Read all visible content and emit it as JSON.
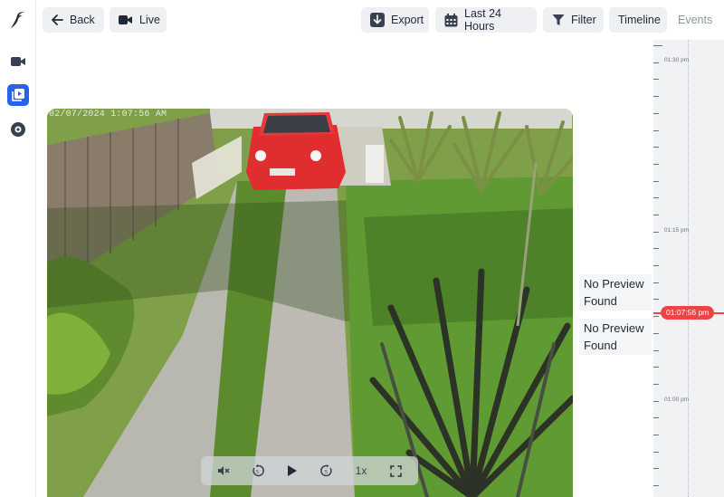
{
  "sidebar": {
    "logo": "bird-logo",
    "items": [
      {
        "name": "cameras",
        "icon": "video-camera-icon",
        "active": false
      },
      {
        "name": "recordings",
        "icon": "play-library-icon",
        "active": true
      },
      {
        "name": "storage",
        "icon": "disc-icon",
        "active": false
      }
    ]
  },
  "toolbar": {
    "back_label": "Back",
    "live_label": "Live",
    "export_label": "Export",
    "range_label": "Last 24 Hours",
    "filter_label": "Filter",
    "timeline_label": "Timeline",
    "events_label": "Events"
  },
  "video": {
    "timestamp": "02/07/2024 1:07:56 AM"
  },
  "controls": {
    "mute_icon": "mute-icon",
    "rewind_icon": "rewind-5-icon",
    "play_icon": "play-icon",
    "forward_icon": "forward-5-icon",
    "speed_label": "1x",
    "fullscreen_icon": "fullscreen-icon"
  },
  "previews": [
    {
      "text": "No Preview Found"
    },
    {
      "text": "No Preview Found"
    }
  ],
  "timeline": {
    "labels": [
      "01:30 pm",
      "01:15 pm",
      "01:00 pm"
    ],
    "current_time": "01:07:56 pm"
  },
  "colors": {
    "accent": "#2563eb",
    "now_marker": "#ef4444",
    "button_bg": "#eef0f3"
  }
}
